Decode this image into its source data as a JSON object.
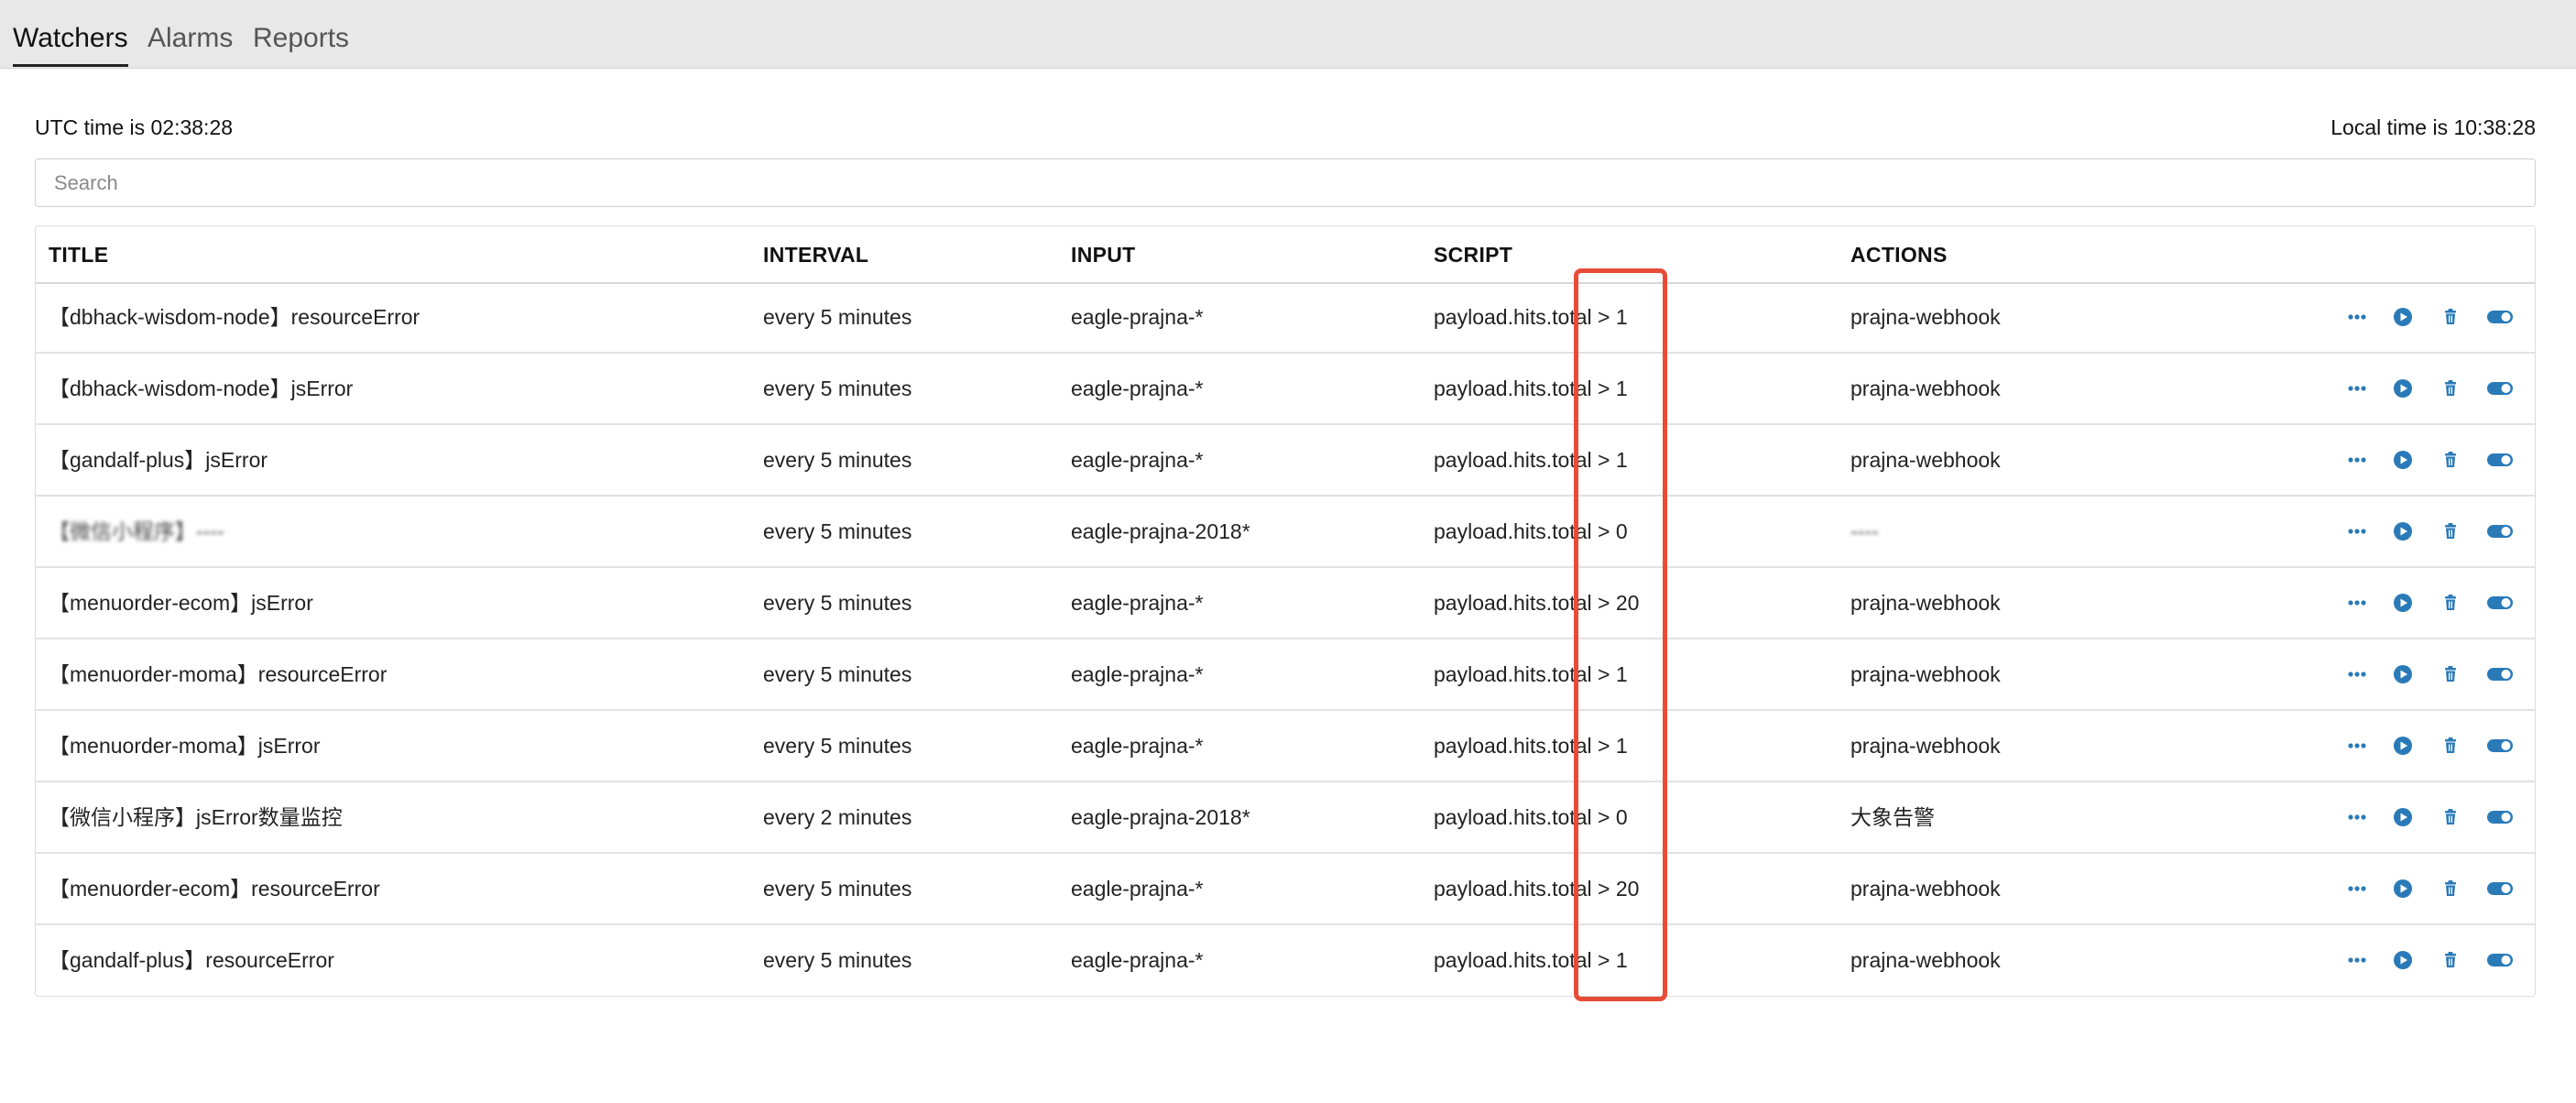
{
  "tabs": [
    {
      "label": "Watchers",
      "active": true
    },
    {
      "label": "Alarms",
      "active": false
    },
    {
      "label": "Reports",
      "active": false
    }
  ],
  "utc_time_text": "UTC time is 02:38:28",
  "local_time_text": "Local time is 10:38:28",
  "search": {
    "placeholder": "Search",
    "value": ""
  },
  "table": {
    "headers": {
      "title": "TITLE",
      "interval": "INTERVAL",
      "input": "INPUT",
      "script": "SCRIPT",
      "actions": "ACTIONS"
    },
    "rows": [
      {
        "title": "【dbhack-wisdom-node】resourceError",
        "interval": "every 5 minutes",
        "input": "eagle-prajna-*",
        "script": "payload.hits.total > 1",
        "action": "prajna-webhook"
      },
      {
        "title": "【dbhack-wisdom-node】jsError",
        "interval": "every 5 minutes",
        "input": "eagle-prajna-*",
        "script": "payload.hits.total > 1",
        "action": "prajna-webhook"
      },
      {
        "title": "【gandalf-plus】jsError",
        "interval": "every 5 minutes",
        "input": "eagle-prajna-*",
        "script": "payload.hits.total > 1",
        "action": "prajna-webhook"
      },
      {
        "title": "【微信小程序】----",
        "interval": "every 5 minutes",
        "input": "eagle-prajna-2018*",
        "script": "payload.hits.total > 0",
        "action": "----",
        "obscured": true
      },
      {
        "title": "【menuorder-ecom】jsError",
        "interval": "every 5 minutes",
        "input": "eagle-prajna-*",
        "script": "payload.hits.total > 20",
        "action": "prajna-webhook"
      },
      {
        "title": "【menuorder-moma】resourceError",
        "interval": "every 5 minutes",
        "input": "eagle-prajna-*",
        "script": "payload.hits.total > 1",
        "action": "prajna-webhook"
      },
      {
        "title": "【menuorder-moma】jsError",
        "interval": "every 5 minutes",
        "input": "eagle-prajna-*",
        "script": "payload.hits.total > 1",
        "action": "prajna-webhook"
      },
      {
        "title": "【微信小程序】jsError数量监控",
        "interval": "every 2 minutes",
        "input": "eagle-prajna-2018*",
        "script": "payload.hits.total > 0",
        "action": "大象告警"
      },
      {
        "title": "【menuorder-ecom】resourceError",
        "interval": "every 5 minutes",
        "input": "eagle-prajna-*",
        "script": "payload.hits.total > 20",
        "action": "prajna-webhook"
      },
      {
        "title": "【gandalf-plus】resourceError",
        "interval": "every 5 minutes",
        "input": "eagle-prajna-*",
        "script": "payload.hits.total > 1",
        "action": "prajna-webhook"
      }
    ],
    "row_actions": [
      "more-icon",
      "play-icon",
      "trash-icon",
      "toggle-icon"
    ]
  },
  "colors": {
    "accent": "#2a7ab8",
    "highlight": "#e84c36"
  }
}
